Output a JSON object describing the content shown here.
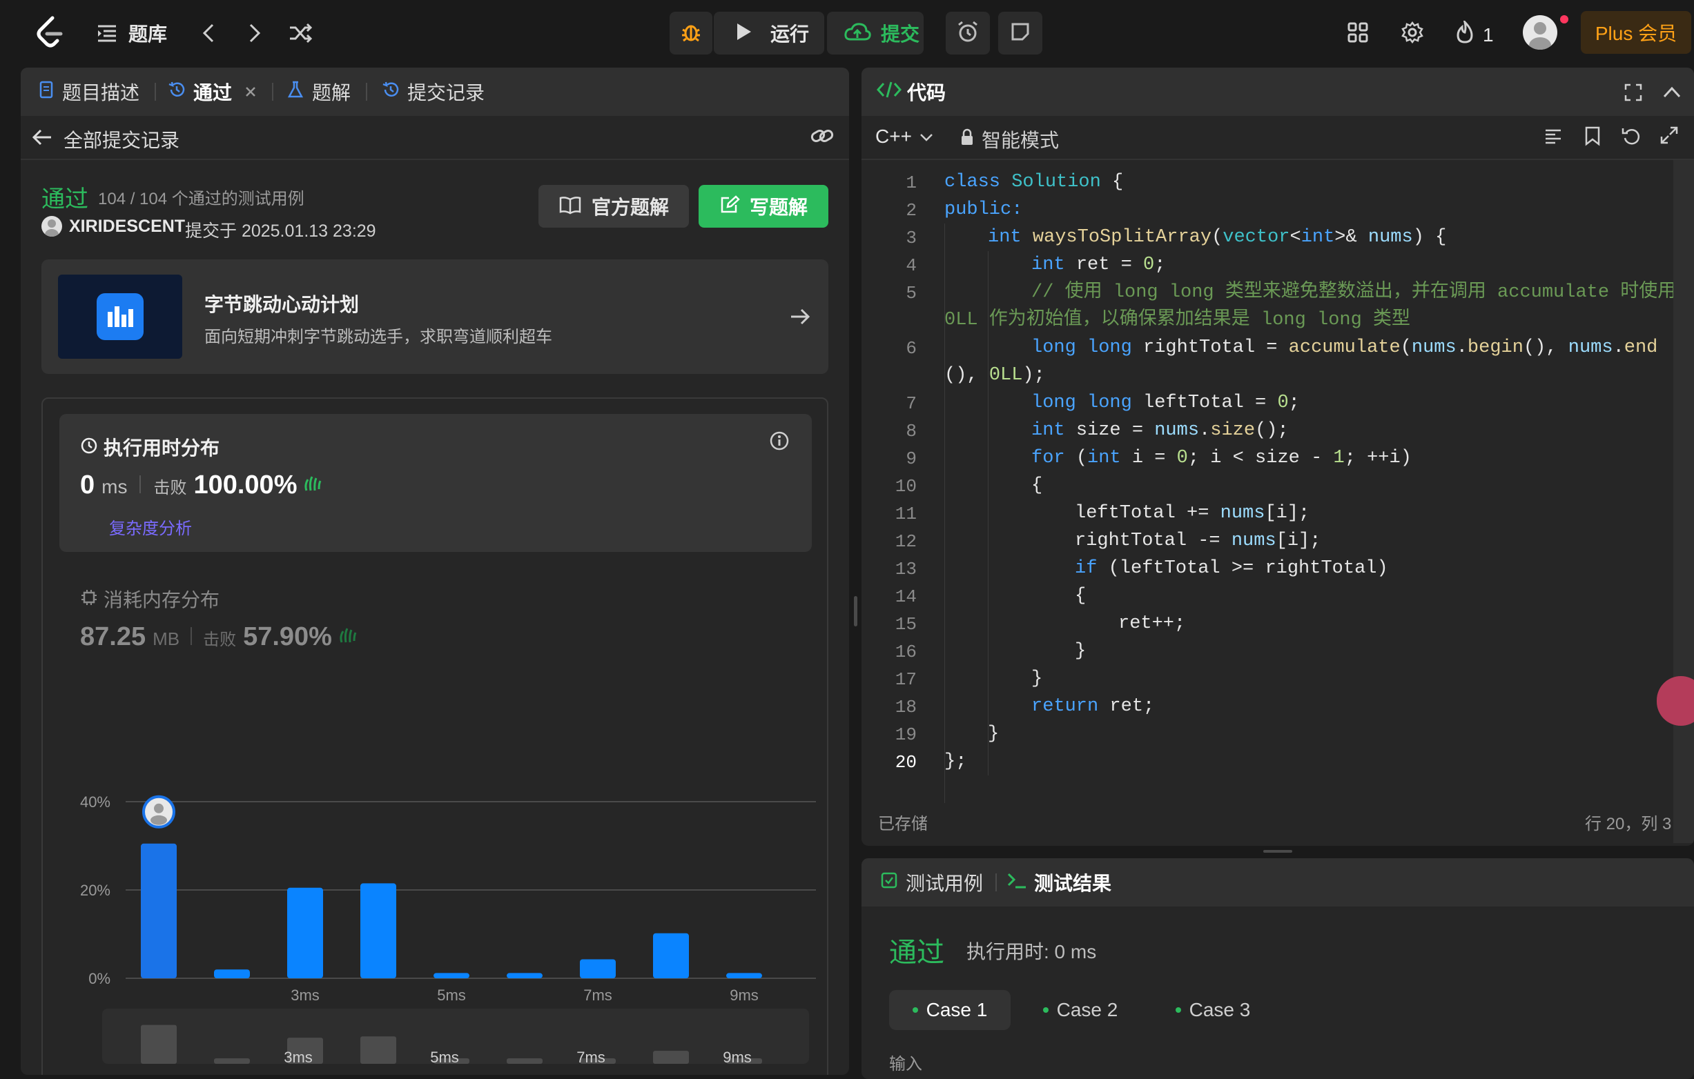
{
  "topbar": {
    "problem_list": "题库",
    "run": "运行",
    "submit": "提交",
    "streak": "1",
    "plus": "Plus 会员"
  },
  "left_tabs": {
    "description": "题目描述",
    "accepted": "通过",
    "solutions": "题解",
    "submissions": "提交记录"
  },
  "back_label": "全部提交记录",
  "result": {
    "status": "通过",
    "cases": "104 / 104 个通过的测试用例",
    "user": "XIRIDESCENT",
    "submitted_at": "提交于 2025.01.13 23:29",
    "official_btn": "官方题解",
    "write_btn": "写题解"
  },
  "banner": {
    "title": "字节跳动心动计划",
    "subtitle": "面向短期冲刺字节跳动选手，求职弯道顺利超车"
  },
  "runtime": {
    "title": "执行用时分布",
    "value": "0",
    "unit": "ms",
    "beats_label": "击败",
    "beats": "100.00%",
    "complexity": "复杂度分析"
  },
  "memory": {
    "title": "消耗内存分布",
    "value": "87.25",
    "unit": "MB",
    "beats_label": "击败",
    "beats": "57.90%"
  },
  "chart_data": {
    "type": "bar",
    "values": [
      30.5,
      2,
      20.5,
      21.5,
      1.2,
      1.2,
      4.3,
      10.2,
      1.2
    ],
    "x_ticks": [
      "",
      "",
      "3ms",
      "",
      "5ms",
      "",
      "7ms",
      "",
      "9ms"
    ],
    "y_ticks": [
      "40%",
      "20%",
      "0%"
    ],
    "ylim": [
      0,
      40
    ],
    "highlight_index": 0,
    "colors": {
      "bar": "#0a84ff",
      "highlight": "#1a73e8"
    }
  },
  "minimap": {
    "labels": [
      "",
      "",
      "3ms",
      "",
      "5ms",
      "",
      "7ms",
      "",
      "9ms"
    ]
  },
  "code_panel": {
    "title": "代码",
    "language": "C++",
    "mode": "智能模式",
    "saved": "已存储",
    "cursor": "行 20，列 3"
  },
  "test_panel": {
    "tab_cases": "测试用例",
    "tab_results": "测试结果",
    "status": "通过",
    "runtime": "执行用时: 0 ms",
    "cases": [
      "Case 1",
      "Case 2",
      "Case 3"
    ],
    "input_label": "输入"
  },
  "colors": {
    "accent_green": "#2cbb5d",
    "blue": "#0a84ff",
    "orange": "#ffa116"
  }
}
